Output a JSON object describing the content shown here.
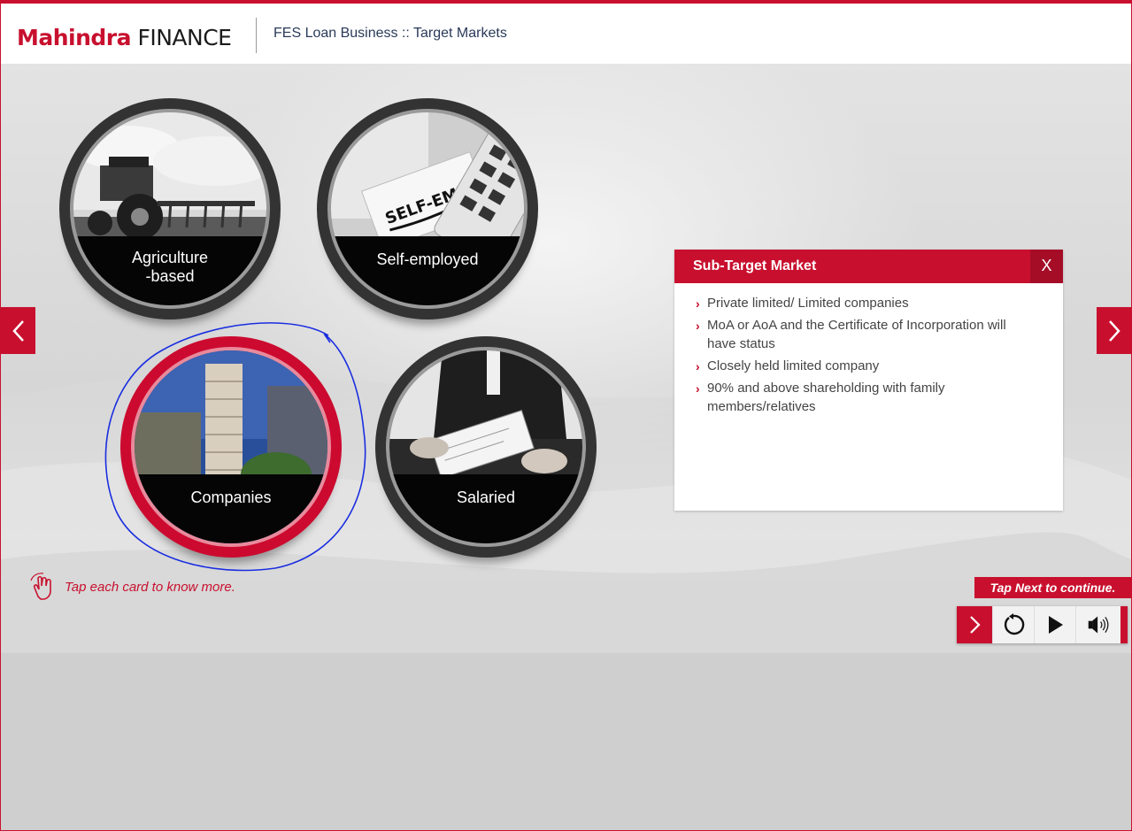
{
  "header": {
    "logo_brand": "Mahindra",
    "logo_suffix": "FINANCE",
    "title": "FES Loan Business :: Target Markets"
  },
  "cards": [
    {
      "label": "Agriculture\n-based",
      "active": false
    },
    {
      "label": "Self-employed",
      "active": false
    },
    {
      "label": "Companies",
      "active": true
    },
    {
      "label": "Salaried",
      "active": false
    }
  ],
  "card_labels": {
    "agri_line1": "Agriculture",
    "agri_line2": "-based",
    "self": "Self-employed",
    "companies": "Companies",
    "salaried": "Salaried"
  },
  "photo_text": {
    "self_employed_note": "SELF-EMPLOYED"
  },
  "popup": {
    "title": "Sub-Target Market",
    "close_label": "X",
    "bullets": [
      "Private limited/ Limited companies",
      "MoA or AoA and the Certificate of Incorporation will have status",
      "Closely held limited company",
      "90% and above shareholding with family members/relatives"
    ]
  },
  "hints": {
    "tap_cards": "Tap each card to know more.",
    "tap_next": "Tap Next to continue."
  },
  "controls": [
    "next-icon",
    "replay-icon",
    "play-icon",
    "volume-icon"
  ],
  "colors": {
    "accent": "#c8102e",
    "annotation": "#1a2ee0"
  }
}
